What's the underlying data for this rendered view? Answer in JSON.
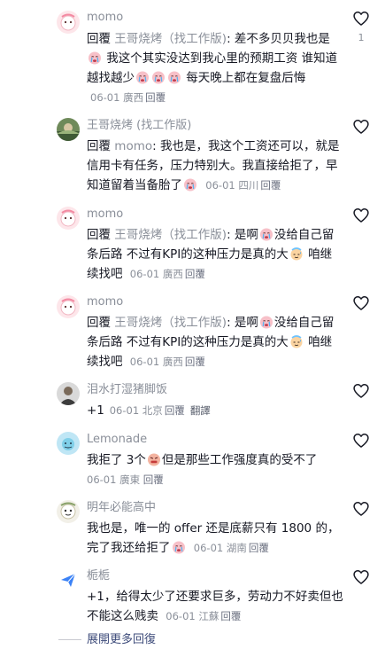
{
  "expand_more_label": "展開更多回復",
  "comments": [
    {
      "username": "momo",
      "reply_word": "回覆",
      "target": "王哥烧烤（找工作版)",
      "parts": [
        ": 差不多贝贝我也是",
        "我这个其实没达到我心里的预期工资 谁知道越找越少",
        "",
        "",
        "每天晚上都在复盘后悔"
      ],
      "meta": "06-01 廣西",
      "reply_label": "回覆",
      "likes": "1"
    },
    {
      "username": "王哥烧烤 (找工作版)",
      "reply_word": "回覆",
      "target": "momo",
      "parts": [
        ": 我也是，我这个工资还可以，就是信用卡有任务，压力特别大。我直接给拒了，早知道留着当备胎了"
      ],
      "meta": "06-01 四川",
      "reply_label": "回覆"
    },
    {
      "username": "momo",
      "reply_word": "回覆",
      "target": "王哥烧烤（找工作版)",
      "parts": [
        ": 是啊",
        "没给自己留条后路 不过有KPI的这种压力是真的大",
        "咱继续找吧"
      ],
      "meta": "06-01 廣西",
      "reply_label": "回覆"
    },
    {
      "username": "momo",
      "reply_word": "回覆",
      "target": "王哥烧烤（找工作版)",
      "parts": [
        ": 是啊",
        "没给自己留条后路 不过有KPI的这种压力是真的大",
        "咱继续找吧"
      ],
      "meta": "06-01 廣西",
      "reply_label": "回覆"
    },
    {
      "username": "泪水打湿猪脚饭",
      "text": "+1",
      "meta": "06-01 北京",
      "reply_label": "回覆",
      "translate_label": "翻譯"
    },
    {
      "username": "Lemonade",
      "parts": [
        "我拒了 3个",
        "但是那些工作强度真的受不了"
      ],
      "meta": "06-01 廣東",
      "reply_label": "回覆"
    },
    {
      "username": "明年必能高中",
      "parts": [
        "我也是，唯一的 offer 还是底薪只有 1800 的，完了我还给拒了"
      ],
      "meta": "06-01 湖南",
      "reply_label": "回覆"
    },
    {
      "username": "栀栀",
      "parts": [
        "+1，给得太少了还要求巨多，劳动力不好卖但也不能这么贱卖"
      ],
      "meta": "06-01 江蘇",
      "reply_label": "回覆"
    }
  ],
  "icons": {
    "heart": "heart-outline-icon",
    "crying_emoji": "crying-face-icon",
    "sweat_emoji": "sweat-face-icon",
    "angry_emoji": "angry-face-icon",
    "plane": "paper-plane-icon"
  }
}
